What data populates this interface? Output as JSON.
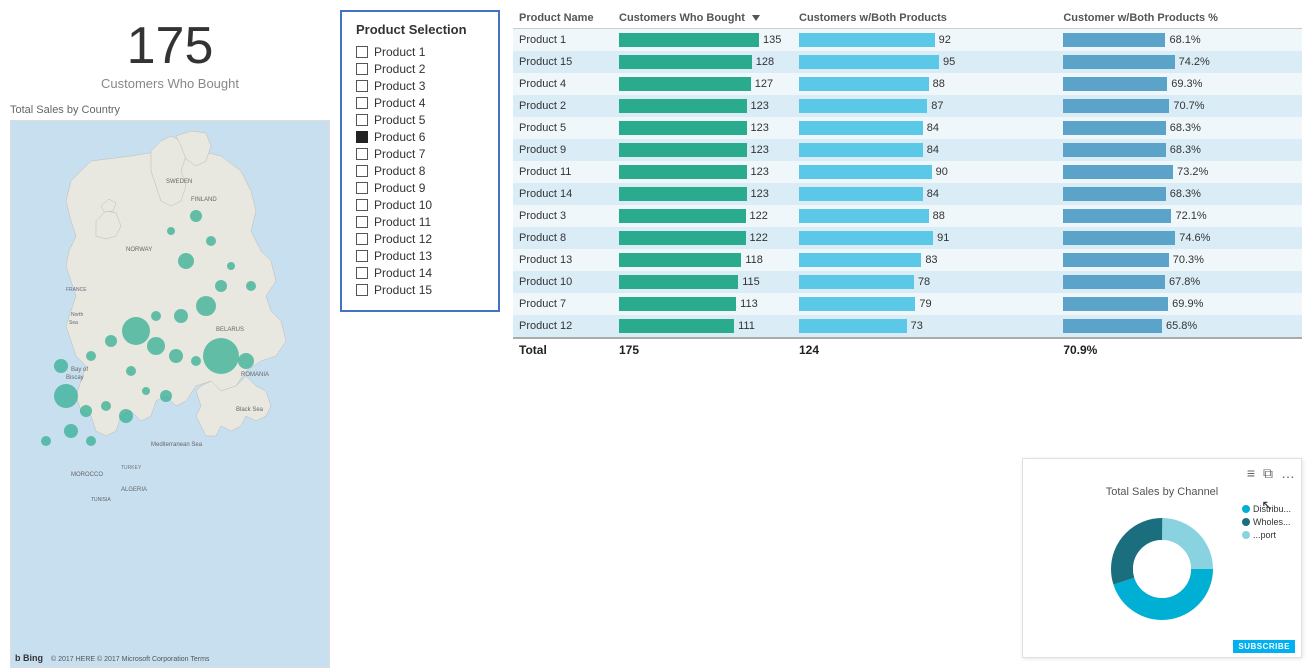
{
  "kpi": {
    "number": "175",
    "label": "Customers Who Bought"
  },
  "map": {
    "label": "Total Sales by Country",
    "bing": "b Bing",
    "copyright": "© 2017 HERE © 2017 Microsoft Corporation Terms"
  },
  "productSelection": {
    "title": "Product Selection",
    "products": [
      {
        "name": "Product 1",
        "checked": false
      },
      {
        "name": "Product 2",
        "checked": false
      },
      {
        "name": "Product 3",
        "checked": false
      },
      {
        "name": "Product 4",
        "checked": false
      },
      {
        "name": "Product 5",
        "checked": false
      },
      {
        "name": "Product 6",
        "checked": true
      },
      {
        "name": "Product 7",
        "checked": false
      },
      {
        "name": "Product 8",
        "checked": false
      },
      {
        "name": "Product 9",
        "checked": false
      },
      {
        "name": "Product 10",
        "checked": false
      },
      {
        "name": "Product 11",
        "checked": false
      },
      {
        "name": "Product 12",
        "checked": false
      },
      {
        "name": "Product 13",
        "checked": false
      },
      {
        "name": "Product 14",
        "checked": false
      },
      {
        "name": "Product 15",
        "checked": false
      }
    ]
  },
  "table": {
    "columns": [
      "Product Name",
      "Customers Who Bought",
      "Customers w/Both Products",
      "Customer w/Both Products %"
    ],
    "rows": [
      {
        "name": "Product 1",
        "bought": 135,
        "both": 92,
        "pct": "68.1%",
        "boughtMax": 135
      },
      {
        "name": "Product 15",
        "bought": 128,
        "both": 95,
        "pct": "74.2%",
        "boughtMax": 135
      },
      {
        "name": "Product 4",
        "bought": 127,
        "both": 88,
        "pct": "69.3%",
        "boughtMax": 135
      },
      {
        "name": "Product 2",
        "bought": 123,
        "both": 87,
        "pct": "70.7%",
        "boughtMax": 135
      },
      {
        "name": "Product 5",
        "bought": 123,
        "both": 84,
        "pct": "68.3%",
        "boughtMax": 135
      },
      {
        "name": "Product 9",
        "bought": 123,
        "both": 84,
        "pct": "68.3%",
        "boughtMax": 135
      },
      {
        "name": "Product 11",
        "bought": 123,
        "both": 90,
        "pct": "73.2%",
        "boughtMax": 135
      },
      {
        "name": "Product 14",
        "bought": 123,
        "both": 84,
        "pct": "68.3%",
        "boughtMax": 135
      },
      {
        "name": "Product 3",
        "bought": 122,
        "both": 88,
        "pct": "72.1%",
        "boughtMax": 135
      },
      {
        "name": "Product 8",
        "bought": 122,
        "both": 91,
        "pct": "74.6%",
        "boughtMax": 135
      },
      {
        "name": "Product 13",
        "bought": 118,
        "both": 83,
        "pct": "70.3%",
        "boughtMax": 135
      },
      {
        "name": "Product 10",
        "bought": 115,
        "both": 78,
        "pct": "67.8%",
        "boughtMax": 135
      },
      {
        "name": "Product 7",
        "bought": 113,
        "both": 79,
        "pct": "69.9%",
        "boughtMax": 135
      },
      {
        "name": "Product 12",
        "bought": 111,
        "both": 73,
        "pct": "65.8%",
        "boughtMax": 135
      }
    ],
    "total": {
      "label": "Total",
      "bought": "175",
      "both": "124",
      "pct": "70.9%"
    }
  },
  "donutChart": {
    "title": "Total Sales by Channel",
    "segments": [
      {
        "label": "Distribu...",
        "color": "#00b0d4",
        "value": 45
      },
      {
        "label": "Wholes...",
        "color": "#1a6e7e",
        "value": 30
      },
      {
        "label": "...port",
        "color": "#89d3e0",
        "value": 25
      }
    ],
    "subscribe": "SUBSCRIBE"
  }
}
